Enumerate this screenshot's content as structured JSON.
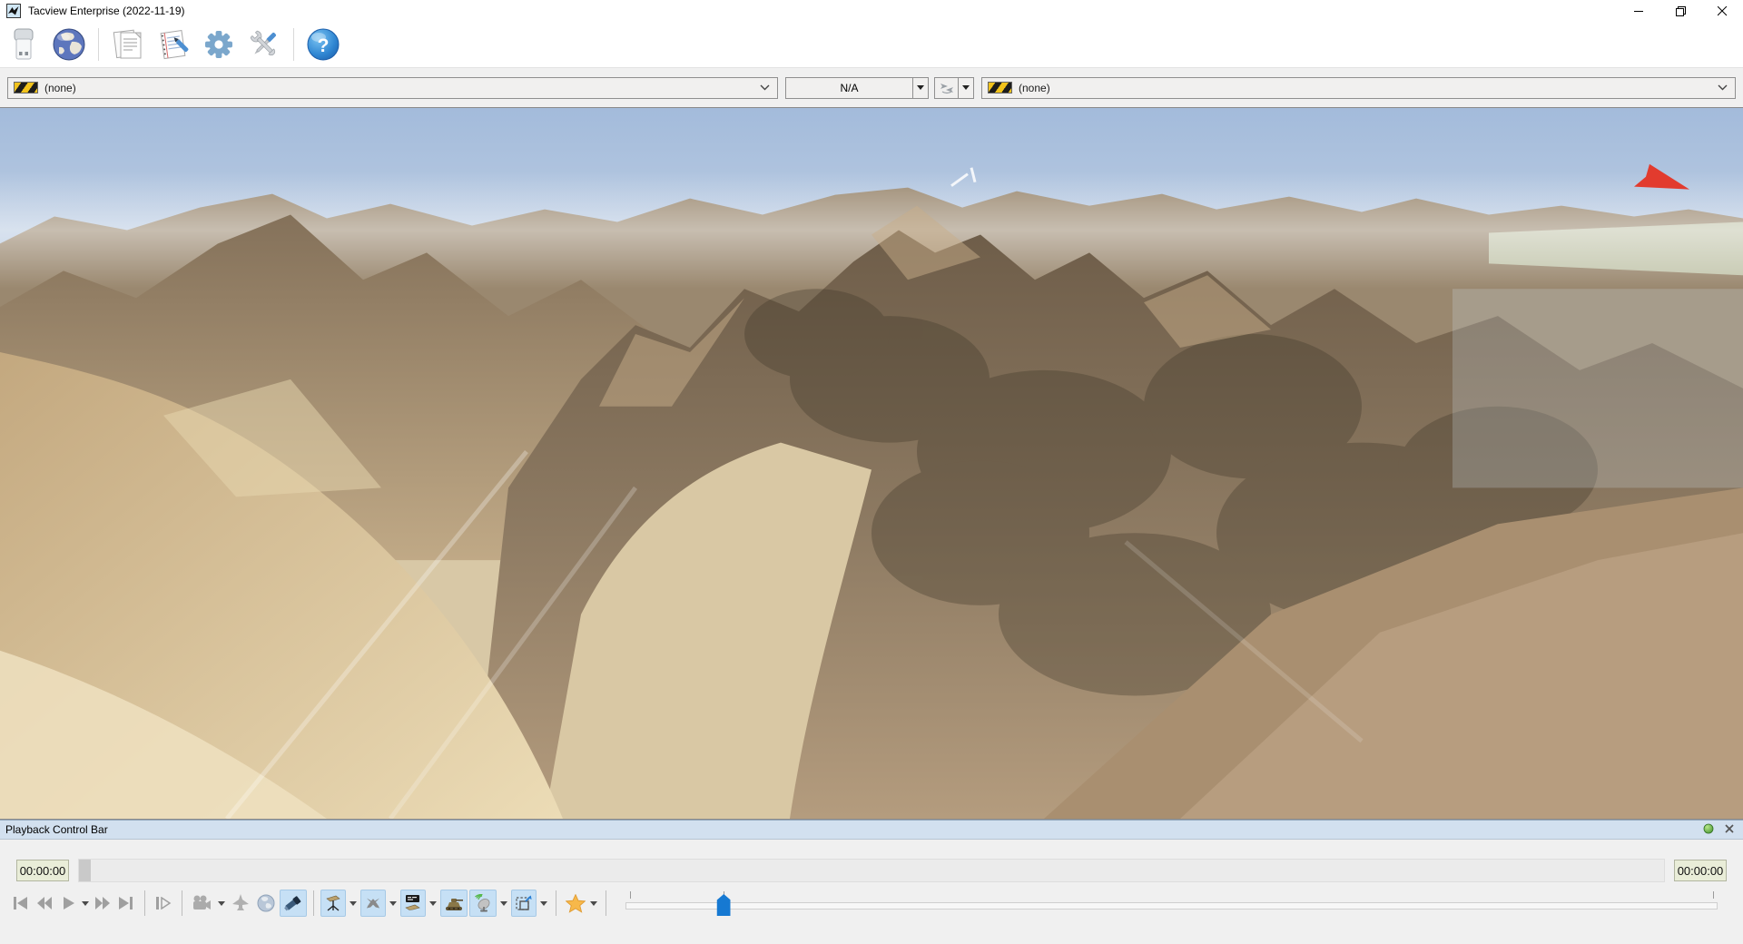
{
  "window": {
    "title": "Tacview Enterprise (2022-11-19)",
    "controls": [
      "minimize",
      "restore",
      "close"
    ]
  },
  "toolbar": {
    "buttons": [
      {
        "icon": "usb-drive-icon"
      },
      {
        "icon": "globe-icon"
      },
      {
        "icon": "documents-icon"
      },
      {
        "icon": "notepad-pen-icon"
      },
      {
        "icon": "gear-icon"
      },
      {
        "icon": "tools-icon"
      },
      {
        "icon": "help-icon"
      }
    ],
    "help_glyph": "?"
  },
  "selection_bar": {
    "primary_object": {
      "value": "(none)",
      "icon": "hazard-stripes-icon"
    },
    "telemetry_value": "N/A",
    "swap_objects_button": {
      "icon": "two-aircraft-icon"
    },
    "secondary_object": {
      "value": "(none)",
      "icon": "hazard-stripes-icon"
    }
  },
  "viewport": {
    "scene": "3D desert mountain terrain under blue sky",
    "sky_color": "#a3bbdb",
    "terrain_colors": [
      "#c3a87f",
      "#8d7a62",
      "#6e5d49",
      "#ecdcb6"
    ],
    "aircraft_marker_color": "#e23b2e"
  },
  "playback": {
    "panel_title": "Playback Control Bar",
    "header_icons": [
      "green-orb-icon",
      "close-icon"
    ],
    "start_time": "00:00:00",
    "end_time": "00:00:00",
    "transport_buttons": [
      "skip-to-start",
      "rewind",
      "play",
      "play-menu",
      "fast-forward",
      "skip-to-end",
      "step-forward"
    ],
    "view_buttons": [
      "camera-icon",
      "jet-icon",
      "globe-icon",
      "spyglass-icon"
    ],
    "toggle_buttons": [
      "aircraft-on-stand-icon",
      "crossed-aircraft-icon",
      "aircraft-billboard-icon",
      "tank-icon",
      "radar-dish-icon",
      "dashed-frame-icon"
    ],
    "bookmark_button": "star-icon",
    "speed_slider": {
      "handle_percent": 9,
      "ticks_percent": [
        0.4,
        9,
        99.6
      ]
    }
  }
}
